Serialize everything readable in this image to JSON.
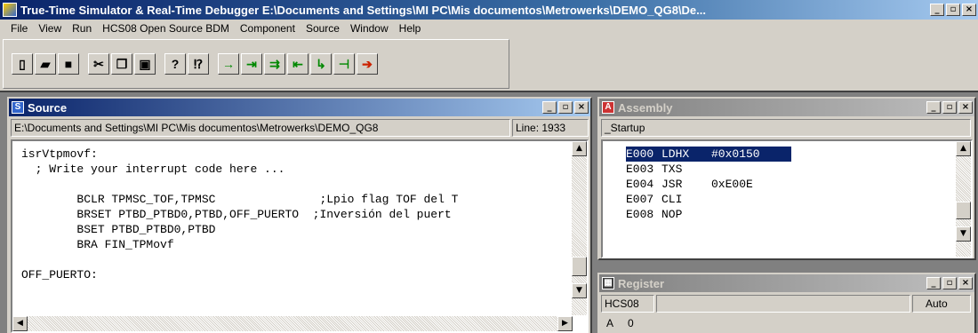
{
  "window": {
    "title": "True-Time Simulator & Real-Time Debugger  E:\\Documents and Settings\\MI PC\\Mis documentos\\Metrowerks\\DEMO_QG8\\De...",
    "min_label": "_",
    "restore_label": "▫",
    "close_label": "×"
  },
  "menu": [
    "File",
    "View",
    "Run",
    "HCS08 Open Source BDM",
    "Component",
    "Source",
    "Window",
    "Help"
  ],
  "toolbar": {
    "buttons": [
      {
        "name": "new-file-icon",
        "glyph": "▯"
      },
      {
        "name": "open-folder-icon",
        "glyph": "▰"
      },
      {
        "name": "save-icon",
        "glyph": "■"
      },
      {
        "name": "cut-icon",
        "glyph": "✂"
      },
      {
        "name": "copy-icon",
        "glyph": "❐"
      },
      {
        "name": "paste-icon",
        "glyph": "▣"
      },
      {
        "name": "help-icon",
        "glyph": "?"
      },
      {
        "name": "context-help-icon",
        "glyph": "⁉"
      },
      {
        "name": "start-continue-icon",
        "glyph": "→"
      },
      {
        "name": "single-step-icon",
        "glyph": "⇥"
      },
      {
        "name": "step-over-icon",
        "glyph": "⇉"
      },
      {
        "name": "step-out-icon",
        "glyph": "⇤"
      },
      {
        "name": "assembly-step-icon",
        "glyph": "↳"
      },
      {
        "name": "halt-icon",
        "glyph": "⊣"
      },
      {
        "name": "reset-icon",
        "glyph": "➔"
      }
    ]
  },
  "source": {
    "title": "Source",
    "icon_letter": "S",
    "path": "E:\\Documents and Settings\\MI PC\\Mis documentos\\Metrowerks\\DEMO_QG8",
    "line": "Line: 1933",
    "lines": [
      "isrVtpmovf:",
      "  ; Write your interrupt code here ...",
      "",
      "        BCLR TPMSC_TOF,TPMSC               ;Lpio flag TOF del T",
      "        BRSET PTBD_PTBD0,PTBD,OFF_PUERTO  ;Inversión del puert",
      "        BSET PTBD_PTBD0,PTBD",
      "        BRA FIN_TPMovf",
      "",
      "OFF_PUERTO:"
    ]
  },
  "assembly": {
    "title": "Assembly",
    "icon_letter": "A",
    "function": "_Startup",
    "rows": [
      {
        "addr": "E000",
        "op": "LDHX",
        "arg": "#0x0150",
        "selected": true
      },
      {
        "addr": "E003",
        "op": "TXS",
        "arg": "",
        "selected": false
      },
      {
        "addr": "E004",
        "op": "JSR",
        "arg": "0xE00E",
        "selected": false
      },
      {
        "addr": "E007",
        "op": "CLI",
        "arg": "",
        "selected": false
      },
      {
        "addr": "E008",
        "op": "NOP",
        "arg": "",
        "selected": false
      }
    ]
  },
  "register": {
    "title": "Register",
    "cpu": "HCS08",
    "mode": "Auto",
    "partial_row": "A     0"
  }
}
